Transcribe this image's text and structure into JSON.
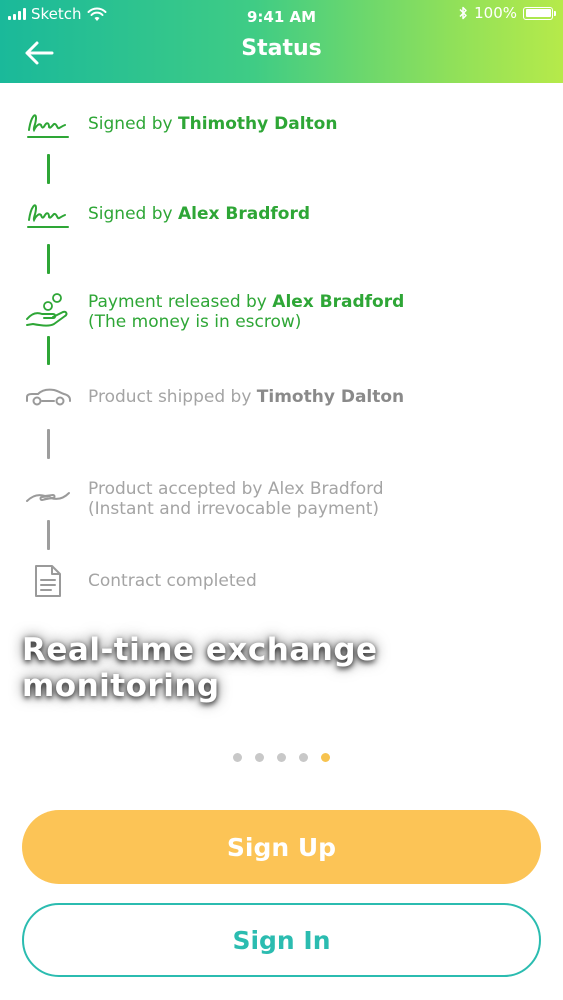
{
  "status_bar": {
    "carrier": "Sketch",
    "time": "9:41 AM",
    "battery": "100%",
    "battery_level": 1.0,
    "icons": [
      "signal-icon",
      "wifi-icon",
      "bluetooth-icon",
      "battery-icon"
    ]
  },
  "nav": {
    "title": "Status",
    "back_icon": "arrow-left-icon"
  },
  "steps": [
    {
      "state": "done",
      "icon": "signature-icon",
      "text": "Signed by ",
      "name": "Thimothy Dalton",
      "note": ""
    },
    {
      "state": "done",
      "icon": "signature-icon",
      "text": "Signed by ",
      "name": "Alex Bradford",
      "note": ""
    },
    {
      "state": "done",
      "icon": "payment-hand-icon",
      "text": "Payment released by ",
      "name": "Alex Bradford",
      "note": "(The money is in escrow)"
    },
    {
      "state": "pending",
      "icon": "car-icon",
      "text": "Product shipped by ",
      "name": "Timothy Dalton",
      "note": ""
    },
    {
      "state": "pending",
      "icon": "handshake-icon",
      "text": "Product accepted by Alex Bradford",
      "name": "",
      "note": "(Instant and irrevocable payment)"
    },
    {
      "state": "pending",
      "icon": "document-icon",
      "text": "Contract completed",
      "name": "",
      "note": ""
    }
  ],
  "caption": {
    "line1": "Real-time exchange",
    "line2": "monitoring"
  },
  "pager": {
    "count": 5,
    "active": 5
  },
  "buttons": {
    "sign_up": "Sign Up",
    "sign_in": "Sign In"
  },
  "colors": {
    "done": "#2ea636",
    "pending": "#a4a4a4",
    "accent_yellow": "#fcc456",
    "accent_teal": "#2bbcb0",
    "header_gradient_start": "#1ab99a",
    "header_gradient_end": "#b6ea4a"
  }
}
